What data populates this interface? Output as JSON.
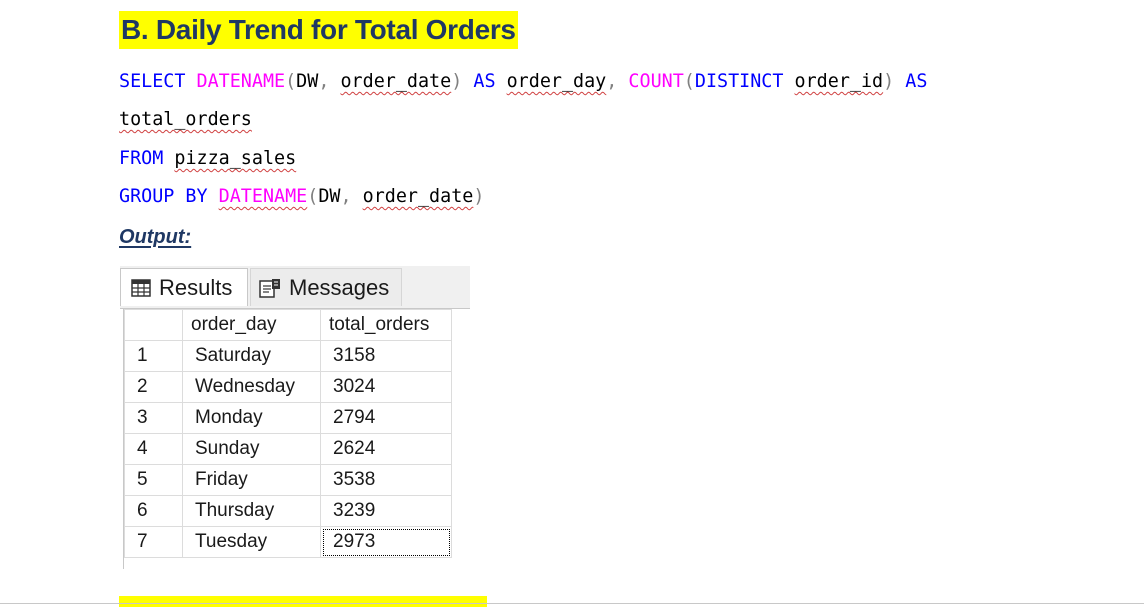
{
  "heading": "B. Daily Trend for Total Orders",
  "sql": {
    "l1_select": "SELECT",
    "l1_fn1": "DATENAME",
    "l1_args_open": "(DW,",
    "l1_col": "order_date",
    "l1_close": ")",
    "l1_as": "AS",
    "l1_alias": "order_day",
    "l1_comma": ",",
    "l1_fn2": "COUNT",
    "l1_paren": "(",
    "l1_distinct": "DISTINCT",
    "l1_col2": "order_id",
    "l1_close2": ")",
    "l1_as2": "AS",
    "l2_alias": "total_orders",
    "l3_from": "FROM",
    "l3_table": "pizza_sales",
    "l4_group": "GROUP BY",
    "l4_fn": "DATENAME",
    "l4_args": "(DW,",
    "l4_col": "order_date",
    "l4_close": ")"
  },
  "output_label": "Output:",
  "tabs": {
    "results": "Results",
    "messages": "Messages"
  },
  "grid": {
    "headers": [
      "",
      "order_day",
      "total_orders"
    ],
    "rows": [
      [
        "1",
        "Saturday",
        "3158"
      ],
      [
        "2",
        "Wednesday",
        "3024"
      ],
      [
        "3",
        "Monday",
        "2794"
      ],
      [
        "4",
        "Sunday",
        "2624"
      ],
      [
        "5",
        "Friday",
        "3538"
      ],
      [
        "6",
        "Thursday",
        "3239"
      ],
      [
        "7",
        "Tuesday",
        "2973"
      ]
    ]
  },
  "colors": {
    "heading_bg": "#ffff00",
    "heading_text": "#1f3864",
    "keyword": "#0000ff",
    "function": "#ff00ff",
    "operator": "#808080"
  },
  "icons": {
    "results_tab": "grid-icon",
    "messages_tab": "messages-icon"
  }
}
